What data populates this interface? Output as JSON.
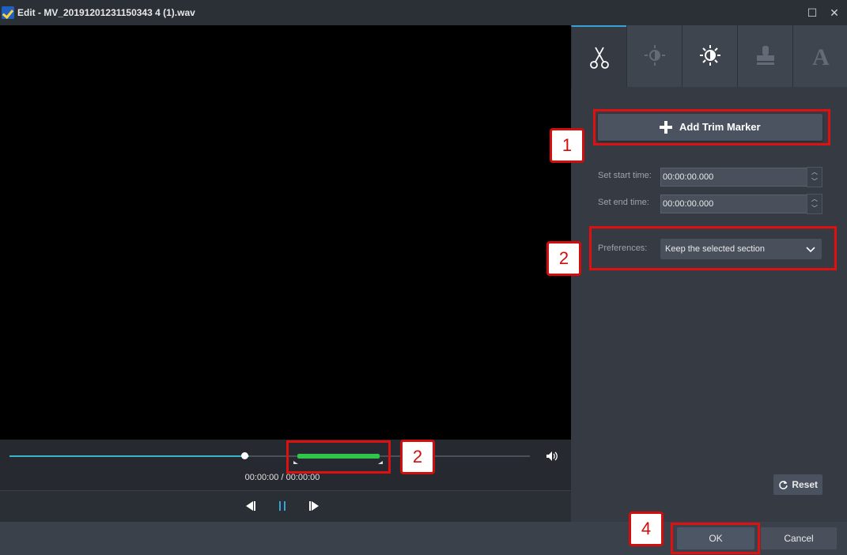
{
  "window": {
    "title": "Edit - MV_20191201231150343 4 (1).wav"
  },
  "player": {
    "time_display": "00:00:00 / 00:00:00",
    "played_fraction": 0.46
  },
  "tabs": [
    {
      "icon": "scissors-icon",
      "active": true
    },
    {
      "icon": "contrast-dim-icon",
      "active": false
    },
    {
      "icon": "brightness-icon",
      "active": false
    },
    {
      "icon": "stamp-icon",
      "active": false
    },
    {
      "icon": "text-icon",
      "active": false,
      "glyph": "A"
    }
  ],
  "trim": {
    "add_marker_label": "Add Trim Marker",
    "start_label": "Set start time:",
    "start_value": "00:00:00.000",
    "end_label": "Set end time:",
    "end_value": "00:00:00.000",
    "preferences_label": "Preferences:",
    "preferences_value": "Keep the selected section",
    "reset_label": "Reset"
  },
  "footer": {
    "ok_label": "OK",
    "cancel_label": "Cancel"
  },
  "annotations": [
    "1",
    "2",
    "2",
    "4"
  ],
  "colors": {
    "accent": "#3bb3c8",
    "trim_range": "#2ec54a",
    "highlight": "#e01010"
  }
}
